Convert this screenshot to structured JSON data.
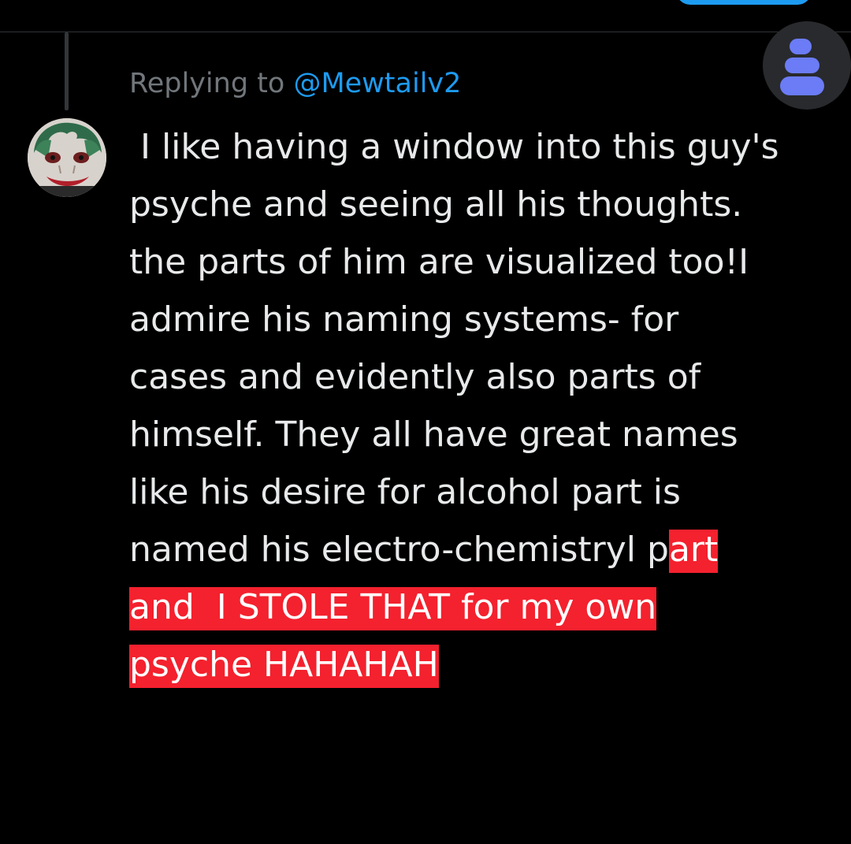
{
  "reply": {
    "prefix": "Replying to ",
    "handle": "@Mewtailv2"
  },
  "tweet": {
    "lines": [
      " I like having a window into this guy's",
      "psyche and seeing all his thoughts.",
      "the parts of him are visualized too!I",
      "admire his naming systems- for",
      "cases and evidently also parts of",
      "himself. They all have great names",
      "like his desire for alcohol part is"
    ],
    "line8_plain": "named his electro-chemistryl p",
    "line8_highlight": "art",
    "line9_highlight": "and  I STOLE THAT for my own",
    "line10_highlight": "psyche HAHAHAH"
  },
  "icons": {
    "fab": "stacked-bars-icon",
    "avatar": "profile-avatar"
  },
  "colors": {
    "background": "#000000",
    "text": "#e7e9ea",
    "muted": "#71767b",
    "link": "#1d9bf0",
    "highlight": "#f4212e",
    "fab_icon": "#6b7cf6"
  }
}
